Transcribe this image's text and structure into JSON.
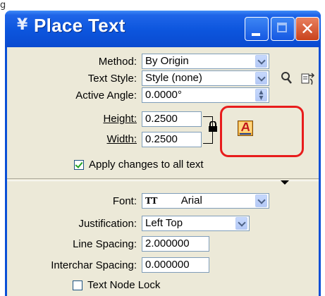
{
  "figure_label": "g",
  "window": {
    "title": "Place Text",
    "min_label": "_",
    "close_label": "✕"
  },
  "method": {
    "label": "Method:",
    "value": "By Origin"
  },
  "text_style": {
    "label": "Text Style:",
    "value": "Style (none)"
  },
  "active_angle": {
    "label": "Active Angle:",
    "value": "0.0000°"
  },
  "height": {
    "label": "Height:",
    "value": "0.2500"
  },
  "width": {
    "label": "Width:",
    "value": "0.2500"
  },
  "apply_changes": {
    "label": "Apply changes to all text",
    "checked": true
  },
  "font": {
    "label": "Font:",
    "value": "Arial",
    "type_icon": "TT"
  },
  "justification": {
    "label": "Justification:",
    "value": "Left Top"
  },
  "line_spacing": {
    "label": "Line Spacing:",
    "value": "2.000000"
  },
  "interchar_spacing": {
    "label": "Interchar Spacing:",
    "value": "0.000000"
  },
  "text_node_lock": {
    "label": "Text Node Lock",
    "checked": false
  },
  "icons": {
    "title": "place-text-tool-icon",
    "match": "magnifier-icon",
    "edit_style": "edit-text-style-icon",
    "text_editor": "text-editor-icon"
  },
  "colors": {
    "titlebar": "#0c55dd",
    "client": "#ece9d8",
    "highlight": "#e81c1c",
    "close": "#d24d26"
  }
}
